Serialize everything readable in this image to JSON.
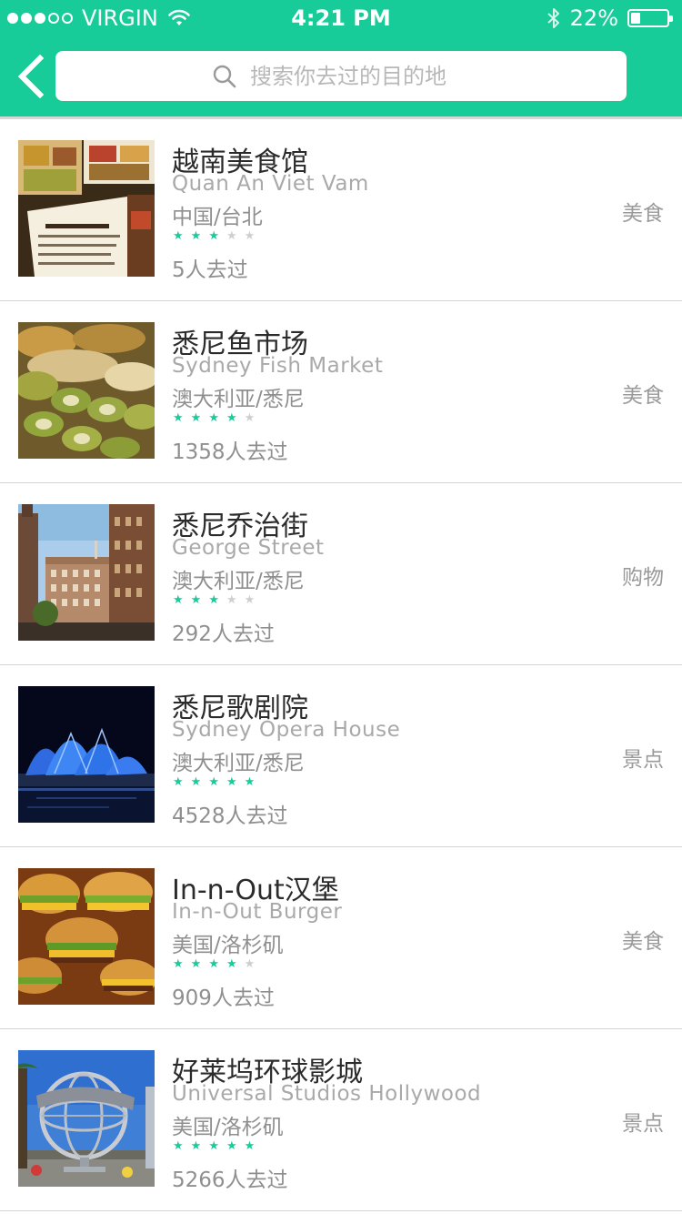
{
  "status": {
    "carrier": "VIRGIN",
    "time": "4:21 PM",
    "battery": "22%",
    "signal_bars_on": 3,
    "signal_bars_total": 5
  },
  "nav": {
    "back_icon": "chevron-left-icon",
    "search_placeholder": "搜索你去过的目的地"
  },
  "colors": {
    "accent": "#17cc99",
    "star_on": "#17cc99",
    "star_off": "#cfcfcf"
  },
  "items": [
    {
      "title": "越南美食馆",
      "subtitle": "Quan An Viet Vam",
      "location": "中国/台北",
      "rating": 3,
      "visitors": "5人去过",
      "category": "美食"
    },
    {
      "title": "悉尼鱼市场",
      "subtitle": "Sydney Fish Market",
      "location": "澳大利亚/悉尼",
      "rating": 4,
      "visitors": "1358人去过",
      "category": "美食"
    },
    {
      "title": "悉尼乔治街",
      "subtitle": "George Street",
      "location": "澳大利亚/悉尼",
      "rating": 3,
      "visitors": "292人去过",
      "category": "购物"
    },
    {
      "title": "悉尼歌剧院",
      "subtitle": "Sydney Opera House",
      "location": "澳大利亚/悉尼",
      "rating": 5,
      "visitors": "4528人去过",
      "category": "景点"
    },
    {
      "title": "In-n-Out汉堡",
      "subtitle": "In-n-Out Burger",
      "location": "美国/洛杉矶",
      "rating": 4,
      "visitors": "909人去过",
      "category": "美食"
    },
    {
      "title": "好莱坞环球影城",
      "subtitle": "Universal Studios Hollywood",
      "location": "美国/洛杉矶",
      "rating": 5,
      "visitors": "5266人去过",
      "category": "景点"
    }
  ]
}
